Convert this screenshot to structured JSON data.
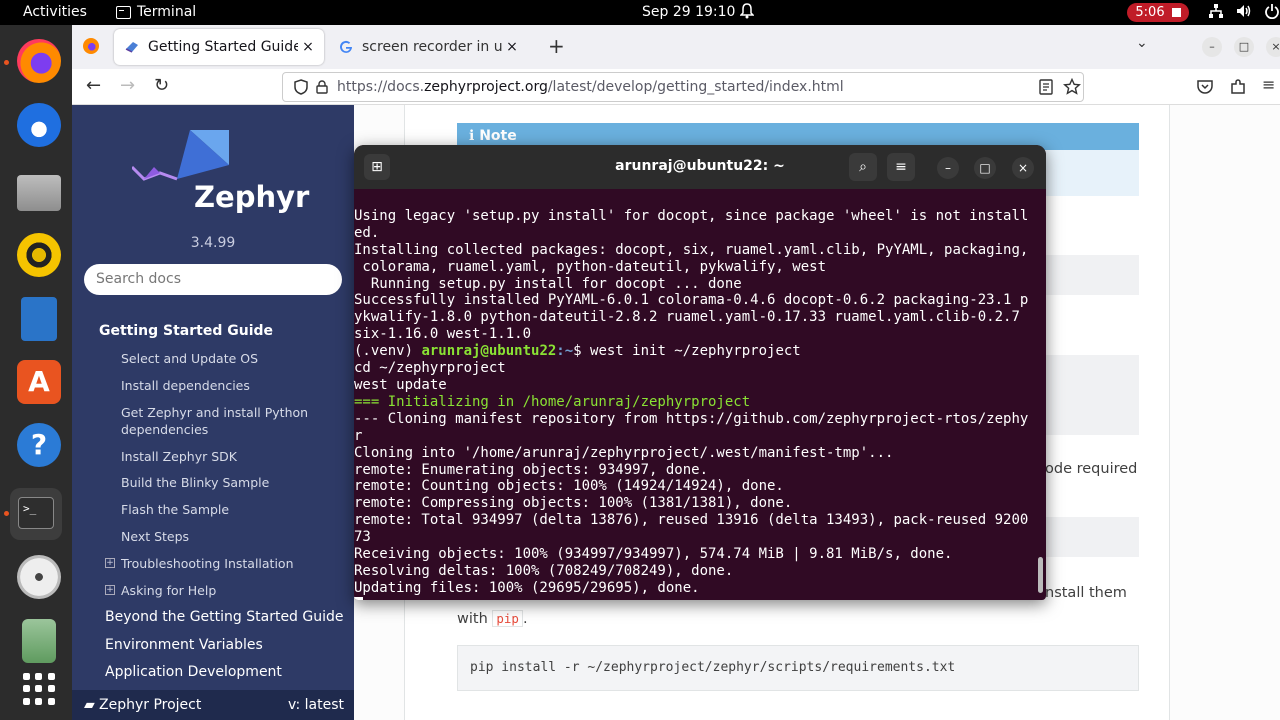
{
  "topbar": {
    "activities": "Activities",
    "app_name": "Terminal",
    "clock": "Sep 29  19:10",
    "recording_time": "5:06",
    "icons": [
      "bell-icon",
      "network-icon",
      "volume-icon",
      "power-icon"
    ]
  },
  "dock": {
    "apps": [
      "Firefox",
      "Thunderbird",
      "Files",
      "Rhythmbox",
      "LibreOffice Writer",
      "Ubuntu Software",
      "Help",
      "Terminal",
      "Disc",
      "Trash",
      "Show Applications"
    ],
    "terminal_glyph": ">_"
  },
  "browser": {
    "tabs": [
      {
        "title": "Getting Started Guide —",
        "close": "×",
        "active": true
      },
      {
        "title": "screen recorder in ubuntu",
        "close": "×",
        "active": false
      }
    ],
    "new_tab": "+",
    "list_all_tabs": "⌄",
    "url": {
      "prefix": "https://docs.",
      "domain": "zephyrproject.org",
      "path": "/latest/develop/getting_started/index.html"
    }
  },
  "sidebar": {
    "brand": "Zephyr",
    "version": "3.4.99",
    "search_placeholder": "Search docs",
    "nav": {
      "current": "Getting Started Guide",
      "items": [
        "Select and Update OS",
        "Install dependencies",
        "Get Zephyr and install Python",
        "dependencies",
        "Install Zephyr SDK",
        "Build the Blinky Sample",
        "Flash the Sample",
        "Next Steps",
        "Troubleshooting Installation",
        "Asking for Help"
      ],
      "top_level": [
        "Beyond the Getting Started Guide",
        "Environment Variables",
        "Application Development"
      ]
    },
    "footer": {
      "project": "Zephyr Project",
      "version": "v: latest"
    }
  },
  "content": {
    "note_title": "Note",
    "partial_text_1": "ode required",
    "partial_text_2": "nstall them",
    "with_text": "with",
    "pip_code": "pip",
    "period": ".",
    "code_block": "pip install -r ~/zephyrproject/zephyr/scripts/requirements.txt"
  },
  "terminal": {
    "title": "arunraj@ubuntu22: ~",
    "lines": [
      "Using legacy 'setup.py install' for docopt, since package 'wheel' is not install",
      "ed.",
      "Installing collected packages: docopt, six, ruamel.yaml.clib, PyYAML, packaging,",
      " colorama, ruamel.yaml, python-dateutil, pykwalify, west",
      "  Running setup.py install for docopt ... done",
      "Successfully installed PyYAML-6.0.1 colorama-0.4.6 docopt-0.6.2 packaging-23.1 p",
      "ykwalify-1.8.0 python-dateutil-2.8.2 ruamel.yaml-0.17.33 ruamel.yaml.clib-0.2.7",
      "six-1.16.0 west-1.1.0"
    ],
    "prompt": {
      "venv": "(.venv) ",
      "user": "arunraj@ubuntu22",
      "path": ":~",
      "sign": "$ ",
      "command": "west init ~/zephyrproject"
    },
    "lines2": [
      "cd ~/zephyrproject",
      "west update"
    ],
    "highlight_line": "=== Initializing in /home/arunraj/zephyrproject",
    "lines3": [
      "--- Cloning manifest repository from https://github.com/zephyrproject-rtos/zephy",
      "r",
      "Cloning into '/home/arunraj/zephyrproject/.west/manifest-tmp'...",
      "remote: Enumerating objects: 934997, done.",
      "remote: Counting objects: 100% (14924/14924), done.",
      "remote: Compressing objects: 100% (1381/1381), done.",
      "remote: Total 934997 (delta 13876), reused 13916 (delta 13493), pack-reused 9200",
      "73",
      "Receiving objects: 100% (934997/934997), 574.74 MiB | 9.81 MiB/s, done.",
      "Resolving deltas: 100% (708249/708249), done.",
      "Updating files: 100% (29695/29695), done."
    ]
  }
}
